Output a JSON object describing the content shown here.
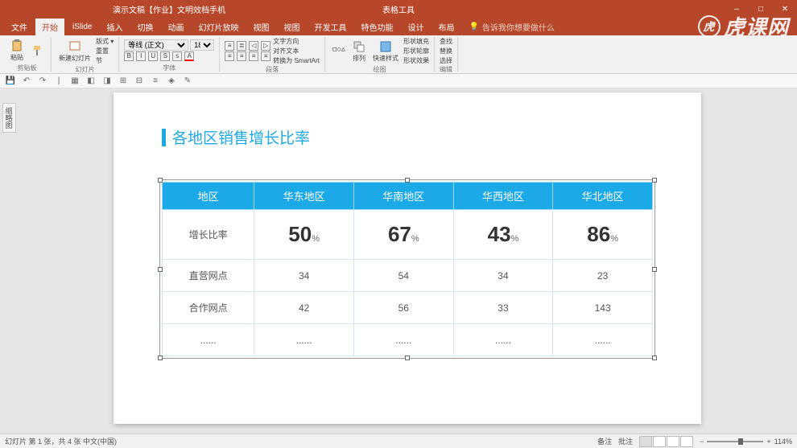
{
  "titlebar": {
    "doc_title": "演示文稿【作业】文明效档手机",
    "context_tab": "表格工具",
    "win_min": "–",
    "win_max": "□",
    "win_close": "✕"
  },
  "menubar": {
    "tabs": [
      "文件",
      "开始",
      "iSlide",
      "插入",
      "切换",
      "动画",
      "幻灯片放映",
      "视图",
      "视图",
      "开发工具",
      "特色功能",
      "设计",
      "布局"
    ],
    "active_index": 1,
    "search_icon": "💡",
    "search_placeholder": "告诉我你想要做什么"
  },
  "ribbon": {
    "paste": "粘贴",
    "clipboard_label": "剪贴板",
    "new_slide": "新建幻灯片",
    "reset": "重置",
    "section": "节",
    "slides_label": "幻灯片",
    "font_name": "等线 (正文)",
    "font_size": "18",
    "font_label": "字体",
    "paragraph_label": "段落",
    "text_dir": "文字方向",
    "align_text": "对齐文本",
    "smartart": "转换为 SmartArt",
    "drawing_label": "绘图",
    "shapes": "形状",
    "arrange": "排列",
    "quick_style": "快速样式",
    "shape_fill": "形状填充",
    "shape_outline": "形状轮廓",
    "shape_effects": "形状效果",
    "find": "查找",
    "replace": "替换",
    "select": "选择",
    "editing_label": "编辑"
  },
  "sidetab": "缩略图",
  "slide": {
    "title": "各地区销售增长比率",
    "headers": [
      "地区",
      "华东地区",
      "华南地区",
      "华西地区",
      "华北地区"
    ],
    "rows": [
      {
        "label": "增长比率",
        "type": "pct",
        "cells": [
          "50",
          "67",
          "43",
          "86"
        ],
        "highlight": true
      },
      {
        "label": "直营网点",
        "cells": [
          "34",
          "54",
          "34",
          "23"
        ]
      },
      {
        "label": "合作网点",
        "cells": [
          "42",
          "56",
          "33",
          "143"
        ]
      },
      {
        "label": "......",
        "cells": [
          "......",
          "......",
          "......",
          "......"
        ]
      }
    ],
    "pct_unit": "%"
  },
  "statusbar": {
    "left": "幻灯片 第 1 张，共 4 张    中文(中国)",
    "notes": "备注",
    "comments": "批注",
    "zoom": "114%",
    "zoom_plus": "+",
    "zoom_minus": "−"
  },
  "watermark": "虎课网",
  "chart_data": {
    "type": "table",
    "title": "各地区销售增长比率",
    "columns": [
      "地区",
      "华东地区",
      "华南地区",
      "华西地区",
      "华北地区"
    ],
    "rows": [
      [
        "增长比率",
        "50%",
        "67%",
        "43%",
        "86%"
      ],
      [
        "直营网点",
        34,
        54,
        34,
        23
      ],
      [
        "合作网点",
        42,
        56,
        33,
        143
      ],
      [
        "......",
        "......",
        "......",
        "......",
        "......"
      ]
    ]
  }
}
